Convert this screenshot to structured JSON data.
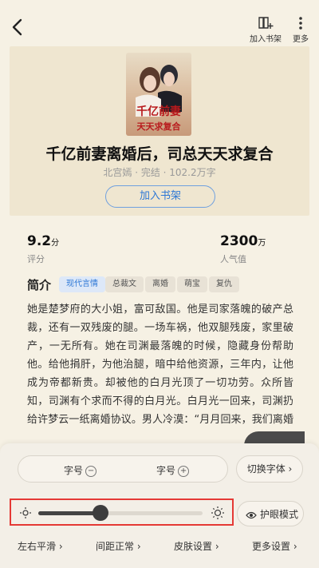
{
  "topbar": {
    "add_shelf_label": "加入书架",
    "more_label": "更多"
  },
  "book": {
    "cover_title": "千亿前妻 离婚后，司总天天求复合",
    "title": "千亿前妻离婚后，司总天天求复合",
    "meta": "北宫嫣 · 完结 · 102.2万字",
    "add_button": "加入书架"
  },
  "stats": {
    "rating_value": "9.2",
    "rating_unit": "分",
    "rating_label": "评分",
    "popularity_value": "2300",
    "popularity_unit": "万",
    "popularity_label": "人气值"
  },
  "intro": {
    "heading": "简介",
    "tags": [
      "现代言情",
      "总裁文",
      "离婚",
      "萌宝",
      "复仇"
    ],
    "text": "她是楚梦府的大小姐，富可敌国。他是司家落魄的破产总裁，还有一双残废的腿。一场车祸，他双腿残废，家里破产，一无所有。她在司渊最落魄的时候，隐藏身份帮助他。给他捐肝，为他治腿，暗中给他资源，三年内，让他成为帝都新贵。却被他的白月光顶了一切功劳。众所皆知，司渊有个求而不得的白月光。白月光一回来，司渊扔给许梦云一纸离婚协议。男人冷漠：“月月回来，我们离婚吧。”许梦云看着三年都捂不热的男人，彻底死心了。她爽快答应：“司渊，你别"
  },
  "panel": {
    "font_size_label": "字号",
    "minus": "−",
    "plus": "+",
    "switch_font": "切换字体 ›",
    "brightness_level": 0.38,
    "eye_mode": "护眼模式",
    "bottom": [
      "左右平滑 ›",
      "间距正常 ›",
      "皮肤设置 ›",
      "更多设置 ›"
    ]
  },
  "colors": {
    "accent_blue": "#2e78d6",
    "highlight_red": "#e53935",
    "background": "#f6f1e4"
  }
}
